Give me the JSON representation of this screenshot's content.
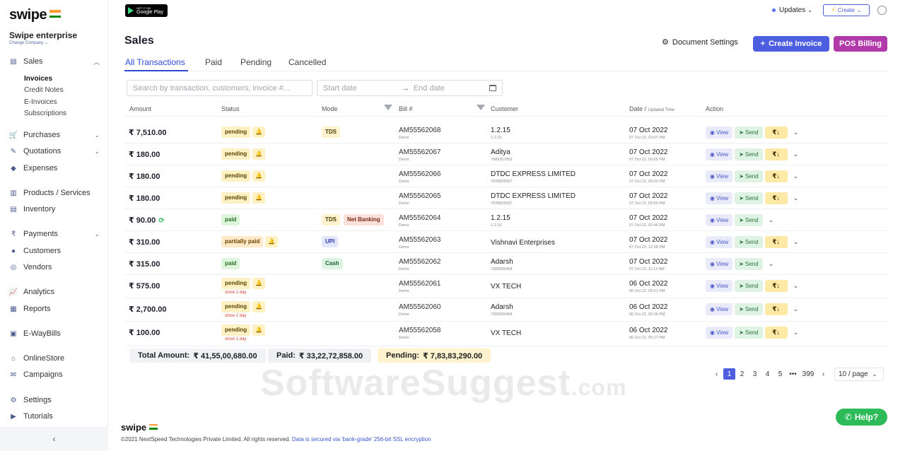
{
  "sidebar": {
    "brand": "swipe",
    "company": "Swipe enterprise",
    "change_company": "Change Company ⌄",
    "sales_label": "Sales",
    "sub_items": [
      "Invoices",
      "Credit Notes",
      "E-Invoices",
      "Subscriptions"
    ],
    "items": [
      {
        "label": "Purchases",
        "icon": "cart-icon"
      },
      {
        "label": "Quotations",
        "icon": "pen-icon"
      },
      {
        "label": "Expenses",
        "icon": "tag-icon"
      },
      {
        "label": "Products / Services",
        "icon": "barcode-icon"
      },
      {
        "label": "Inventory",
        "icon": "chart-icon"
      },
      {
        "label": "Payments",
        "icon": "rupee-icon"
      },
      {
        "label": "Customers",
        "icon": "user-icon"
      },
      {
        "label": "Vendors",
        "icon": "users-icon"
      },
      {
        "label": "Analytics",
        "icon": "analytics-icon"
      },
      {
        "label": "Reports",
        "icon": "reports-icon"
      },
      {
        "label": "E-WayBills",
        "icon": "truck-icon"
      },
      {
        "label": "OnlineStore",
        "icon": "store-icon"
      },
      {
        "label": "Campaigns",
        "icon": "megaphone-icon"
      },
      {
        "label": "Settings",
        "icon": "gear-icon"
      },
      {
        "label": "Tutorials",
        "icon": "video-icon"
      }
    ]
  },
  "topbar": {
    "gplay_line1": "GET IT ON",
    "gplay_line2": "Google Play",
    "updates": "Updates",
    "create": "Create"
  },
  "header": {
    "title": "Sales",
    "doc_settings": "Document Settings",
    "create_invoice": "Create Invoice",
    "pos_billing": "POS Billing"
  },
  "tabs": [
    "All Transactions",
    "Paid",
    "Pending",
    "Cancelled"
  ],
  "filters": {
    "search_placeholder": "Search by transaction, customers, invoice #...",
    "start_date": "Start date",
    "end_date": "End date"
  },
  "columns": {
    "amount": "Amount",
    "status": "Status",
    "mode": "Mode",
    "bill": "Bill #",
    "customer": "Customer",
    "date": "Date /",
    "date_sub": "Updated Time",
    "action": "Action"
  },
  "rows": [
    {
      "amount": "₹ 7,510.00",
      "status": "pending",
      "since": "",
      "modes": [
        "TDS"
      ],
      "bill": "AM55562068",
      "bill_sub": "Demo",
      "customer": "1.2.15",
      "customer_sub": "1.2.15",
      "date": "07 Oct 2022",
      "date_sub": "07 Oct 22, 03:07 PM",
      "pay": true
    },
    {
      "amount": "₹ 180.00",
      "status": "pending",
      "since": "",
      "modes": [],
      "bill": "AM55562067",
      "bill_sub": "Demo",
      "customer": "Aditya",
      "customer_sub": "7989207852",
      "date": "07 Oct 2022",
      "date_sub": "07 Oct 22, 03:05 PM",
      "pay": true
    },
    {
      "amount": "₹ 180.00",
      "status": "pending",
      "since": "",
      "modes": [],
      "bill": "AM55562066",
      "bill_sub": "Demo",
      "customer": "DTDC EXPRESS LIMITED",
      "customer_sub": "7978826057",
      "date": "07 Oct 2022",
      "date_sub": "07 Oct 22, 03:02 PM",
      "pay": true
    },
    {
      "amount": "₹ 180.00",
      "status": "pending",
      "since": "",
      "modes": [],
      "bill": "AM55562065",
      "bill_sub": "Demo",
      "customer": "DTDC EXPRESS LIMITED",
      "customer_sub": "7978826057",
      "date": "07 Oct 2022",
      "date_sub": "07 Oct 22, 02:59 PM",
      "pay": true
    },
    {
      "amount": "₹ 90.00",
      "status": "paid",
      "since": "",
      "modes": [
        "TDS",
        "Net Banking"
      ],
      "bill": "AM55562064",
      "bill_sub": "Demo",
      "customer": "1.2.15",
      "customer_sub": "1.2.15",
      "date": "07 Oct 2022",
      "date_sub": "07 Oct 22, 02:46 PM",
      "pay": false
    },
    {
      "amount": "₹ 310.00",
      "status": "partially paid",
      "since": "",
      "modes": [
        "UPI"
      ],
      "bill": "AM55562063",
      "bill_sub": "Demo",
      "customer": "Vishnavi Enterprises",
      "customer_sub": "",
      "date": "07 Oct 2022",
      "date_sub": "07 Oct 22, 12:38 PM",
      "pay": true
    },
    {
      "amount": "₹ 315.00",
      "status": "paid",
      "since": "",
      "modes": [
        "Cash"
      ],
      "bill": "AM55562062",
      "bill_sub": "Demo",
      "customer": "Adarsh",
      "customer_sub": "7383035454",
      "date": "07 Oct 2022",
      "date_sub": "07 Oct 22, 11:12 AM",
      "pay": false
    },
    {
      "amount": "₹ 575.00",
      "status": "pending",
      "since": "since 1 day",
      "modes": [],
      "bill": "AM55562061",
      "bill_sub": "Demo",
      "customer": "VX TECH",
      "customer_sub": "",
      "date": "06 Oct 2022",
      "date_sub": "06 Oct 22, 05:51 PM",
      "pay": true
    },
    {
      "amount": "₹ 2,700.00",
      "status": "pending",
      "since": "since 1 day",
      "modes": [],
      "bill": "AM55562060",
      "bill_sub": "Demo",
      "customer": "Adarsh",
      "customer_sub": "7383035454",
      "date": "06 Oct 2022",
      "date_sub": "06 Oct 22, 05:36 PM",
      "pay": true
    },
    {
      "amount": "₹ 100.00",
      "status": "pending",
      "since": "since 1 day",
      "modes": [],
      "bill": "AM55562058",
      "bill_sub": "Demo",
      "customer": "VX TECH",
      "customer_sub": "",
      "date": "06 Oct 2022",
      "date_sub": "06 Oct 22, 05:17 PM",
      "pay": true
    }
  ],
  "actions": {
    "view": "View",
    "send": "Send",
    "rupee": "₹↓"
  },
  "totals": {
    "total_label": "Total Amount:",
    "total_value": "₹ 41,55,00,680.00",
    "paid_label": "Paid:",
    "paid_value": "₹ 33,22,72,858.00",
    "pending_label": "Pending:",
    "pending_value": "₹ 7,83,83,290.00"
  },
  "pagination": {
    "pages": [
      "1",
      "2",
      "3",
      "4",
      "5",
      "•••",
      "399"
    ],
    "active": "1",
    "per_page": "10 / page"
  },
  "watermark": {
    "main": "SoftwareSuggest",
    "suffix": ".com"
  },
  "footer": {
    "brand": "swipe",
    "copyright": "©2021 NextSpeed Technologies Private Limited. All rights reserved.",
    "secure": "Data is secured via 'bank-grade' 256-bit SSL encryption"
  },
  "help": "Help?",
  "colors": {
    "primary": "#4d5fe0",
    "pos": "#b23aa8",
    "help": "#2dbb59"
  }
}
